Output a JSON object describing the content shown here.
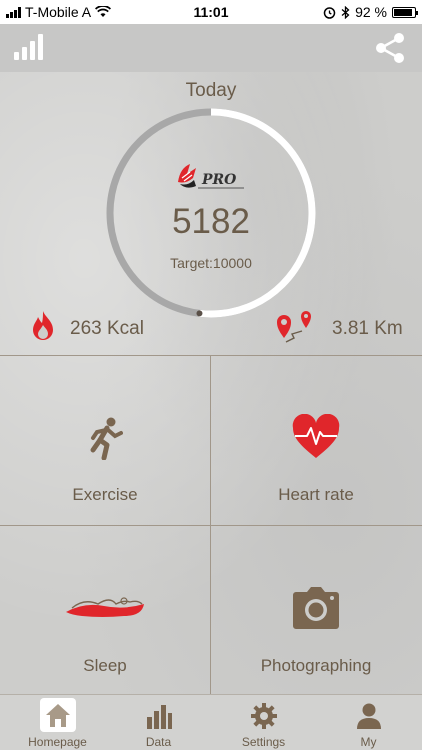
{
  "status_bar": {
    "carrier": "T-Mobile A",
    "time": "11:01",
    "battery_percent": "92 %",
    "battery_level": 0.92
  },
  "header": {
    "signal_icon": "signal-bars-icon",
    "share_icon": "share-icon"
  },
  "dashboard": {
    "period": "Today",
    "logo_text": "PRO",
    "steps": "5182",
    "target": "Target:10000",
    "progress_fraction": 0.5182,
    "calories": "263 Kcal",
    "distance": "3.81 Km"
  },
  "tiles": [
    {
      "label": "Exercise",
      "icon": "running-person-icon"
    },
    {
      "label": "Heart rate",
      "icon": "heart-pulse-icon"
    },
    {
      "label": "Sleep",
      "icon": "sleep-icon"
    },
    {
      "label": "Photographing",
      "icon": "camera-icon"
    }
  ],
  "tabs": [
    {
      "label": "Homepage",
      "icon": "home-icon",
      "active": true
    },
    {
      "label": "Data",
      "icon": "bar-chart-icon",
      "active": false
    },
    {
      "label": "Settings",
      "icon": "gear-icon",
      "active": false
    },
    {
      "label": "My",
      "icon": "person-icon",
      "active": false
    }
  ],
  "colors": {
    "accent_red": "#e0262b",
    "text_brown": "#6a5c4a",
    "ring_white": "#ffffff",
    "ring_gray": "#a8a8a8",
    "icon_brown": "#7a6650"
  }
}
